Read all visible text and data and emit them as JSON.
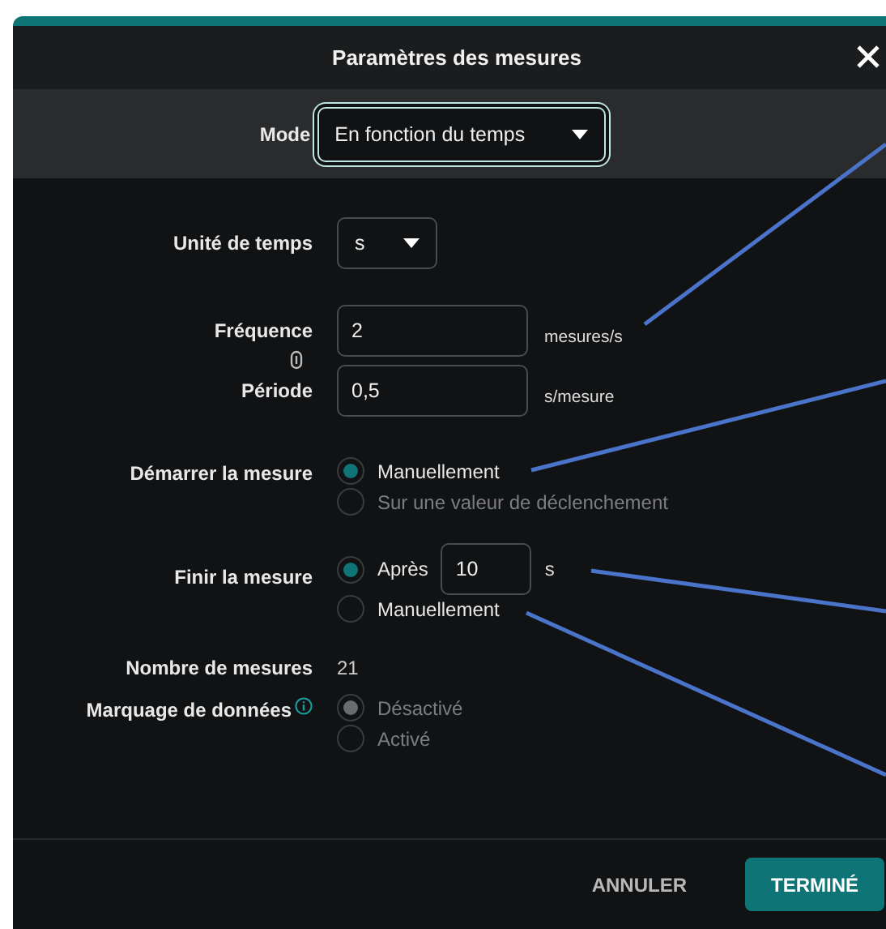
{
  "dialog": {
    "title": "Paramètres des mesures"
  },
  "mode": {
    "label": "Mode",
    "value": "En fonction du temps"
  },
  "time_unit": {
    "label": "Unité de temps",
    "value": "s"
  },
  "frequency": {
    "label": "Fréquence",
    "value": "2",
    "unit": "mesures/s"
  },
  "period": {
    "label": "Période",
    "value": "0,5",
    "unit": "s/mesure"
  },
  "start": {
    "label": "Démarrer la mesure",
    "options": [
      {
        "kind": "plain",
        "label": "Manuellement",
        "selected": true,
        "disabled": false
      },
      {
        "kind": "plain",
        "label": "Sur une valeur de déclenchement",
        "selected": false,
        "disabled": true
      }
    ]
  },
  "end": {
    "label": "Finir la mesure",
    "options": [
      {
        "kind": "duration",
        "label": "Après",
        "value": "10",
        "unit": "s",
        "selected": true,
        "disabled": false
      },
      {
        "kind": "plain",
        "label": "Manuellement",
        "selected": false,
        "disabled": false
      }
    ]
  },
  "sample_count": {
    "label": "Nombre de mesures",
    "value": "21"
  },
  "data_marking": {
    "label": "Marquage de données",
    "options": [
      {
        "kind": "plain",
        "label": "Désactivé",
        "selected": true,
        "disabled": true
      },
      {
        "kind": "plain",
        "label": "Activé",
        "selected": false,
        "disabled": true
      }
    ]
  },
  "buttons": [
    {
      "kind": "text",
      "label": "ANNULER"
    },
    {
      "kind": "primary",
      "label": "TERMINÉ"
    }
  ]
}
